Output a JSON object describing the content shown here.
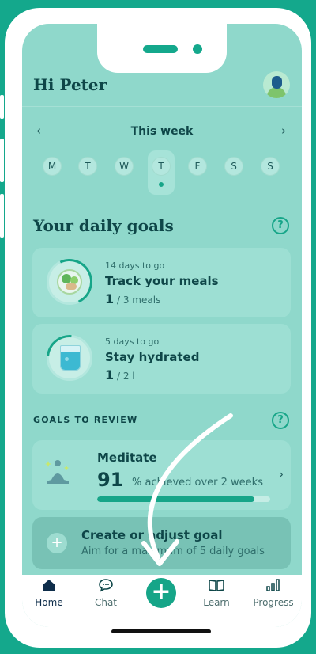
{
  "header": {
    "greeting": "Hi Peter"
  },
  "week": {
    "title": "This week",
    "prev": "‹",
    "next": "›",
    "days": [
      "M",
      "T",
      "W",
      "T",
      "F",
      "S",
      "S"
    ],
    "selected_index": 3
  },
  "daily_goals": {
    "title": "Your daily goals",
    "help": "?",
    "items": [
      {
        "countdown": "14 days to go",
        "title": "Track your meals",
        "current": "1",
        "target": " / 3 meals",
        "icon": "plate-icon"
      },
      {
        "countdown": "5 days to go",
        "title": "Stay hydrated",
        "current": "1",
        "target": " / 2 l",
        "icon": "water-glass-icon"
      }
    ]
  },
  "review": {
    "label": "GOALS TO REVIEW",
    "help": "?",
    "item": {
      "title": "Meditate",
      "value": "91",
      "desc": "% achieved over 2 weeks",
      "progress": 0.91,
      "chevron": "›"
    }
  },
  "create": {
    "plus": "+",
    "title": "Create or adjust goal",
    "subtitle": "Aim for a maximum of 5 daily goals"
  },
  "tabs": [
    {
      "label": "Home",
      "icon": "home-icon"
    },
    {
      "label": "Chat",
      "icon": "chat-icon"
    },
    {
      "label": "Learn",
      "icon": "book-icon"
    },
    {
      "label": "Progress",
      "icon": "chart-icon"
    }
  ],
  "fab": "+",
  "colors": {
    "brand": "#16a588",
    "background": "#8fd8cb",
    "text": "#0e4648"
  }
}
